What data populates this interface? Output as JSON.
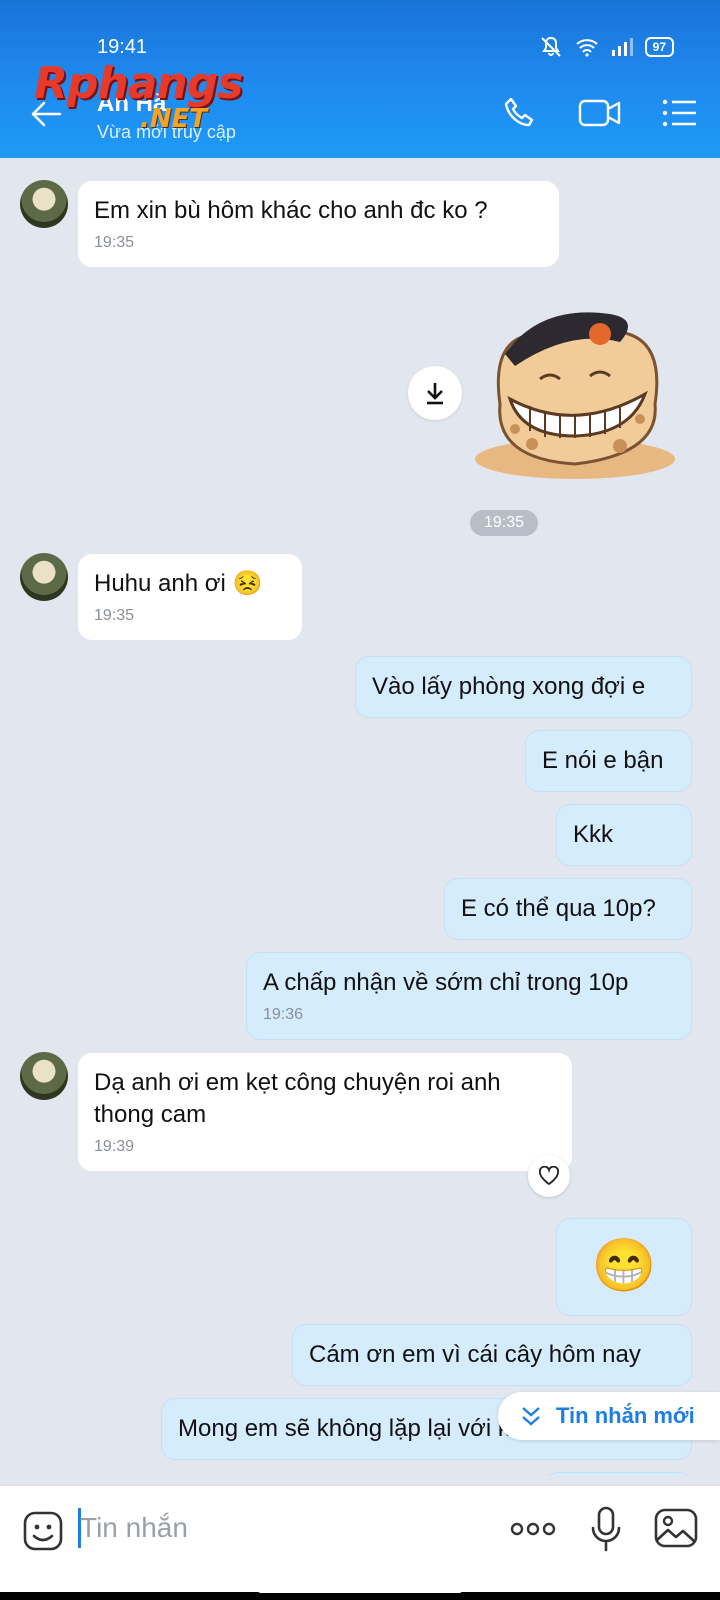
{
  "status_bar": {
    "time": "19:41",
    "battery": "97"
  },
  "header": {
    "contact_name": "An Hà",
    "contact_status": "Vừa mới truy cập",
    "watermark_main": "Rphangs",
    "watermark_sub": ".NET",
    "icons": [
      "back-arrow-icon",
      "phone-icon",
      "video-icon",
      "menu-list-icon"
    ]
  },
  "messages": [
    {
      "side": "in",
      "text": "Em xin bù hôm khác cho anh đc ko ?",
      "time": "19:35"
    },
    {
      "side": "out",
      "sticker": "laughing-blob-sticker",
      "time": "19:35"
    },
    {
      "side": "in",
      "text": "Huhu anh ơi 😣",
      "time": "19:35"
    },
    {
      "side": "out",
      "text": "Vào lấy phòng xong đợi e"
    },
    {
      "side": "out",
      "text": "E nói e bận"
    },
    {
      "side": "out",
      "text": "Kkk"
    },
    {
      "side": "out",
      "text": "E có thể qua 10p?"
    },
    {
      "side": "out",
      "text": "A chấp nhận về sớm chỉ trong 10p",
      "time": "19:36"
    },
    {
      "side": "in",
      "text": "Dạ anh ơi em kẹt công chuyện roi anh thong cam",
      "time": "19:39"
    },
    {
      "side": "out",
      "text": "😁"
    },
    {
      "side": "out",
      "text": "Cám ơn em vì cái cây hôm nay"
    },
    {
      "side": "out",
      "text": "Mong em sẽ không lặp lại với khách khác"
    }
  ],
  "new_messages_label": "Tin nhắn mới",
  "composer": {
    "placeholder": "Tin nhắn"
  }
}
